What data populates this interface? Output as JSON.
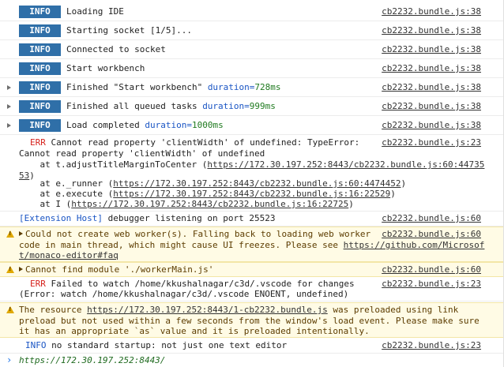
{
  "logs": [
    {
      "badge": "INFO",
      "message": "Loading IDE",
      "source": "cb2232.bundle.js:38",
      "expandable": false
    },
    {
      "badge": "INFO",
      "message": "Starting socket [1/5]...",
      "source": "cb2232.bundle.js:38",
      "expandable": false
    },
    {
      "badge": "INFO",
      "message": "Connected to socket",
      "source": "cb2232.bundle.js:38",
      "expandable": false
    },
    {
      "badge": "INFO",
      "message": "Start workbench",
      "source": "cb2232.bundle.js:38",
      "expandable": false
    },
    {
      "badge": "INFO",
      "message": "Finished \"Start workbench\" ",
      "duration_key": "duration=",
      "duration_val": "728ms",
      "source": "cb2232.bundle.js:38",
      "expandable": true
    },
    {
      "badge": "INFO",
      "message": "Finished all queued tasks ",
      "duration_key": "duration=",
      "duration_val": "999ms",
      "source": "cb2232.bundle.js:38",
      "expandable": true
    },
    {
      "badge": "INFO",
      "message": "Load completed ",
      "duration_key": "duration=",
      "duration_val": "1000ms",
      "source": "cb2232.bundle.js:38",
      "expandable": true
    }
  ],
  "error1": {
    "label": "ERR",
    "line1": " Cannot read property 'clientWidth' of undefined: TypeError:",
    "line2": "Cannot read property 'clientWidth' of undefined",
    "source": "cb2232.bundle.js:23",
    "stack": [
      {
        "prefix": "    at t.adjustTitleMarginToCenter (",
        "link": "https://172.30.197.252:8443/cb2232.bundle.js:60:44735",
        "link_part1": "https://172.30.197.252:8443/cb2232.bundle.js:60:44735",
        "link_part2": "53",
        "suffix": ")"
      },
      {
        "prefix": "    at e._runner (",
        "link": "https://172.30.197.252:8443/cb2232.bundle.js:60:4474452",
        "suffix": ")"
      },
      {
        "prefix": "    at e.execute (",
        "link": "https://172.30.197.252:8443/cb2232.bundle.js:16:22529",
        "suffix": ")"
      },
      {
        "prefix": "    at I (",
        "link": "https://172.30.197.252:8443/cb2232.bundle.js:16:22725",
        "suffix": ")"
      }
    ]
  },
  "ext_host": {
    "tag": "[Extension Host]",
    "message": " debugger listening on port 25523",
    "source": "cb2232.bundle.js:60"
  },
  "warn1": {
    "line1": "Could not create web worker(s). Falling back to loading web worker",
    "line2_prefix": "code in main thread, which might cause UI freezes. Please see ",
    "link_part1": "https://github.com/Microsof",
    "link_part2": "t/monaco-editor#faq",
    "source": "cb2232.bundle.js:60"
  },
  "warn2": {
    "message": "Cannot find module './workerMain.js'",
    "source": "cb2232.bundle.js:60"
  },
  "error2": {
    "label": "ERR",
    "line1": " Failed to watch /home/kkushalnagar/c3d/.vscode for changes",
    "line2": "(Error: watch /home/kkushalnagar/c3d/.vscode ENOENT, undefined)",
    "source": "cb2232.bundle.js:23"
  },
  "warn3": {
    "line1_prefix": "The resource ",
    "link": "https://172.30.197.252:8443/1-cb2232.bundle.js",
    "line1_suffix": " was preloaded using link",
    "line2": "preload but not used within a few seconds from the window's load event. Please make sure",
    "line3": "it has an appropriate `as` value and it is preloaded intentionally."
  },
  "info_final": {
    "label": "INFO",
    "message": " no standard startup: not just one text editor",
    "source": "cb2232.bundle.js:23"
  },
  "prompt": {
    "chevron": "›",
    "text": "https://172.30.197.252:8443/"
  }
}
